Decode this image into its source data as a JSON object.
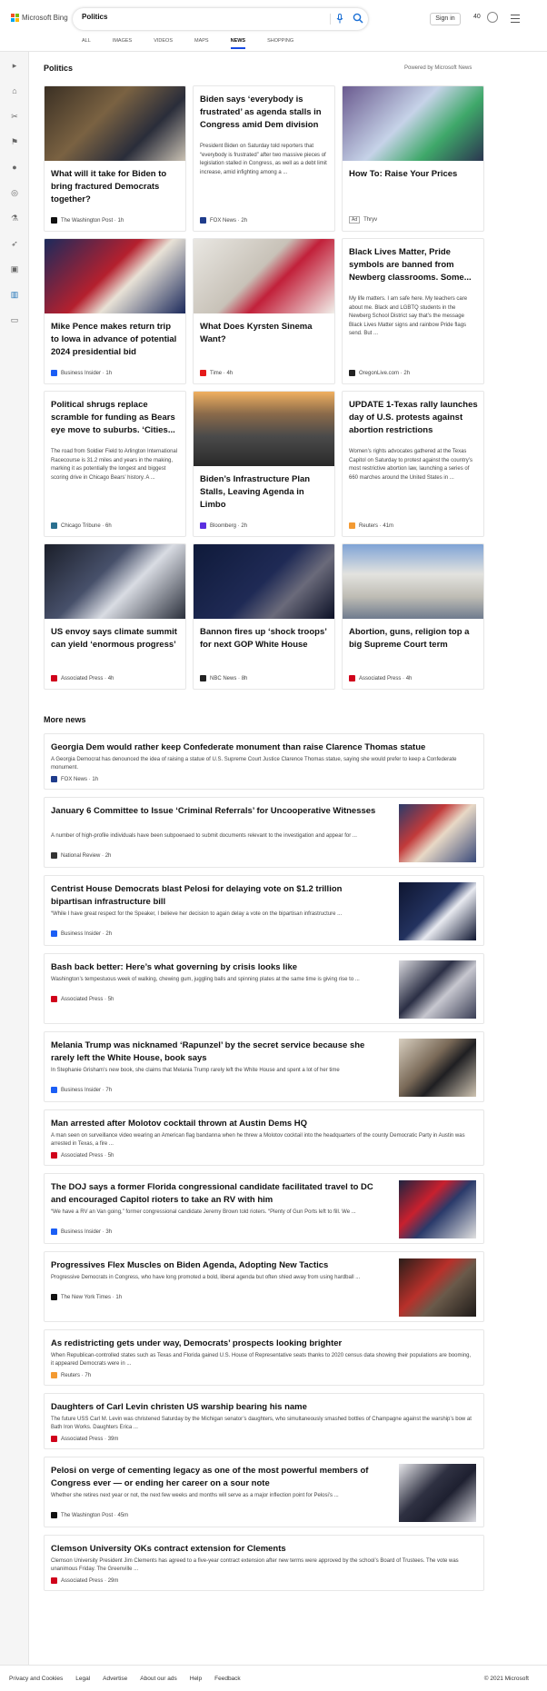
{
  "header": {
    "logo_text": "Microsoft Bing",
    "search_value": "Politics",
    "signin_label": "Sign in",
    "rewards_count": "40"
  },
  "tabs": [
    {
      "label": "ALL"
    },
    {
      "label": "IMAGES"
    },
    {
      "label": "VIDEOS"
    },
    {
      "label": "MAPS"
    },
    {
      "label": "NEWS"
    },
    {
      "label": "SHOPPING"
    }
  ],
  "active_tab": "NEWS",
  "section": {
    "title": "Politics",
    "powered_by": "Powered by Microsoft News"
  },
  "cards": [
    {
      "title": "What will it take for Biden to bring fractured Democrats together?",
      "source": "The Washington Post",
      "time": "1h",
      "favicon_color": "#111111",
      "image": "biden-podium"
    },
    {
      "title": "Biden says ‘everybody is frustrated’ as agenda stalls in Congress amid Dem division",
      "snippet": "President Biden on Saturday told reporters that “everybody is frustrated” after two massive pieces of legislation stalled in Congress, as well as a debt limit increase, amid infighting among a ...",
      "source": "FOX News",
      "time": "2h",
      "favicon_color": "#1f3c8c"
    },
    {
      "title": "How To: Raise Your Prices",
      "source": "Thryv",
      "ad_label": "Ad",
      "time": "",
      "favicon_color": "",
      "image": "phone-graph"
    },
    {
      "title": "Mike Pence makes return trip to Iowa in advance of potential 2024 presidential bid",
      "source": "Business Insider",
      "time": "1h",
      "favicon_color": "#1b5ef5",
      "image": "pence-podium"
    },
    {
      "title": "What Does Kyrsten Sinema Want?",
      "source": "Time",
      "time": "4h",
      "favicon_color": "#e51a1a",
      "image": "sinema-hall"
    },
    {
      "title": "Black Lives Matter, Pride symbols are banned from Newberg classrooms. Some...",
      "snippet": "My life matters. I am safe here. My teachers care about me. Black and LGBTQ students in the Newberg School District say that’s the message Black Lives Matter signs and rainbow Pride flags send. But ...",
      "source": "OregonLive.com",
      "time": "2h",
      "favicon_color": "#222222"
    },
    {
      "title": "Political shrugs replace scramble for funding as Bears eye move to suburbs. ‘Cities...",
      "snippet": "The road from Soldier Field to Arlington International Racecourse is 31.2 miles and years in the making, marking it as potentially the longest and biggest scoring drive in Chicago Bears’ history. A ...",
      "source": "Chicago Tribune",
      "time": "6h",
      "favicon_color": "#2a6f8f"
    },
    {
      "title": "Biden’s Infrastructure Plan Stalls, Leaving Agenda in Limbo",
      "source": "Bloomberg",
      "time": "2h",
      "favicon_color": "#5a2ee0",
      "image": "highway-aerial"
    },
    {
      "title": "UPDATE 1-Texas rally launches day of U.S. protests against abortion restrictions",
      "snippet": "Women’s rights advocates gathered at the Texas Capitol on Saturday to protest against the country’s most restrictive abortion law, launching a series of 660 marches around the United States in ...",
      "source": "Reuters",
      "time": "41m",
      "favicon_color": "#f39a32"
    },
    {
      "title": "US envoy says climate summit can yield ‘enormous progress’",
      "source": "Associated Press",
      "time": "4h",
      "favicon_color": "#d0021b",
      "image": "kerry-mask"
    },
    {
      "title": "Bannon fires up ‘shock troops’ for next GOP White House",
      "source": "NBC News",
      "time": "8h",
      "favicon_color": "#222222",
      "image": "bannon-dark"
    },
    {
      "title": "Abortion, guns, religion top a big Supreme Court term",
      "source": "Associated Press",
      "time": "4h",
      "favicon_color": "#d0021b",
      "image": "supreme-court"
    }
  ],
  "more_news": {
    "title": "More news",
    "items": [
      {
        "title": "Georgia Dem would rather keep Confederate monument than raise Clarence Thomas statue",
        "snippet": "A Georgia Democrat has denounced the idea of raising a statue of U.S. Supreme Court Justice Clarence Thomas statue, saying she would prefer to keep a Confederate monument.",
        "source": "FOX News",
        "time": "1h",
        "favicon_color": "#1f3c8c"
      },
      {
        "title": "January 6 Committee to Issue ‘Criminal Referrals’ for Uncooperative Witnesses",
        "snippet": "A number of high-profile individuals have been subpoenaed to submit documents relevant to the investigation and appear for ...",
        "source": "National Review",
        "time": "2h",
        "favicon_color": "#333333",
        "image": "committee"
      },
      {
        "title": "Centrist House Democrats blast Pelosi for delaying vote on $1.2 trillion bipartisan infrastructure bill",
        "snippet": "“While I have great respect for the Speaker, I believe her decision to again delay a vote on the bipartisan infrastructure ...",
        "source": "Business Insider",
        "time": "2h",
        "favicon_color": "#1b5ef5",
        "image": "speaker-dark"
      },
      {
        "title": "Bash back better: Here’s what governing by crisis looks like",
        "snippet": "Washington’s tempestuous week of walking, chewing gum, juggling balls and spinning plates at the same time is giving rise to ...",
        "source": "Associated Press",
        "time": "5h",
        "favicon_color": "#d0021b",
        "image": "walking-hall"
      },
      {
        "title": "Melania Trump was nicknamed ‘Rapunzel’ by the secret service because she rarely left the White House, book says",
        "snippet": "In Stephanie Grisham’s new book, she claims that Melania Trump rarely left the White House and spent a lot of her time",
        "source": "Business Insider",
        "time": "7h",
        "favicon_color": "#1b5ef5",
        "image": "melania"
      },
      {
        "title": "Man arrested after Molotov cocktail thrown at Austin Dems HQ",
        "snippet": "A man seen on surveillance video wearing an American flag bandanna when he threw a Molotov cocktail into the headquarters of the county Democratic Party in Austin was arrested in Texas, a fire ...",
        "source": "Associated Press",
        "time": "5h",
        "favicon_color": "#d0021b"
      },
      {
        "title": "The DOJ says a former Florida congressional candidate facilitated travel to DC and encouraged Capitol rioters to take an RV with him",
        "snippet": "“We have a RV an Van going,” former congressional candidate Jeremy Brown told rioters. “Plenty of Gun Ports left to fill. We ...",
        "source": "Business Insider",
        "time": "3h",
        "favicon_color": "#1b5ef5",
        "image": "rioters"
      },
      {
        "title": "Progressives Flex Muscles on Biden Agenda, Adopting New Tactics",
        "snippet": "Progressive Democrats in Congress, who have long promoted a bold, liberal agenda but often shied away from using hardball ...",
        "source": "The New York Times",
        "time": "1h",
        "favicon_color": "#111111",
        "image": "progressives"
      },
      {
        "title": "As redistricting gets under way, Democrats’ prospects looking brighter",
        "snippet": "When Republican-controlled states such as Texas and Florida gained U.S. House of Representative seats thanks to 2020 census data showing their populations are booming, it appeared Democrats were in ...",
        "source": "Reuters",
        "time": "7h",
        "favicon_color": "#f39a32"
      },
      {
        "title": "Daughters of Carl Levin christen US warship bearing his name",
        "snippet": "The future USS Carl M. Levin was christened Saturday by the Michigan senator’s daughters, who simultaneously smashed bottles of Champagne against the warship’s bow at Bath Iron Works. Daughters Erica ...",
        "source": "Associated Press",
        "time": "39m",
        "favicon_color": "#d0021b"
      },
      {
        "title": "Pelosi on verge of cementing legacy as one of the most powerful members of Congress ever — or ending her career on a sour note",
        "snippet": "Whether she retires next year or not, the next few weeks and months will serve as a major inflection point for Pelosi’s ...",
        "source": "The Washington Post",
        "time": "45m",
        "favicon_color": "#111111",
        "image": "pelosi-walk"
      },
      {
        "title": "Clemson University OKs contract extension for Clements",
        "snippet": "Clemson University President Jim Clements has agreed to a five-year contract extension after new terms were approved by the school’s Board of Trustees. The vote was unanimous Friday. The Greenville ...",
        "source": "Associated Press",
        "time": "29m",
        "favicon_color": "#d0021b"
      }
    ]
  },
  "footer": {
    "links": [
      "Privacy and Cookies",
      "Legal",
      "Advertise",
      "About our ads",
      "Help",
      "Feedback"
    ],
    "copyright": "© 2021 Microsoft"
  }
}
